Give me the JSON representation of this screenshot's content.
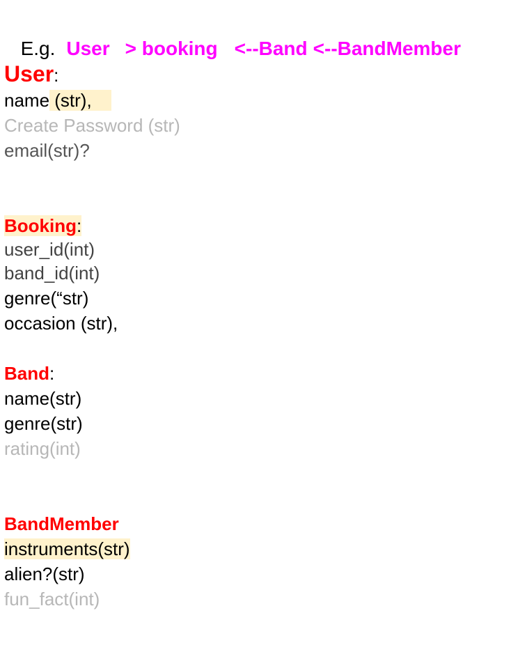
{
  "example": {
    "prefix": "E.g.",
    "user": "User",
    "booking": "> booking",
    "band": "<--Band",
    "bandmember": "<--BandMember"
  },
  "user": {
    "heading": "User",
    "colon": ":",
    "fields": {
      "name": "name",
      "name_type": " (str),",
      "password": "Create Password (str)",
      "email": "email(str)?"
    }
  },
  "booking": {
    "heading": "Booking",
    "colon": ":",
    "fields": {
      "user_id": "user_id(int)",
      "band_id": "band_id(int)",
      "genre": "genre(“str)",
      "occasion": "occasion (str),"
    }
  },
  "band": {
    "heading": "Band",
    "colon": ":",
    "fields": {
      "name": "name(str)",
      "genre": "genre(str)",
      "rating": "rating(int)"
    }
  },
  "bandmember": {
    "heading": "BandMember",
    "fields": {
      "instruments": "instruments(str)",
      "alien": "alien?(str)",
      "fun_fact": "fun_fact(int)"
    }
  },
  "colors": {
    "heading": "#ff0000",
    "example_accent": "#ff00ff",
    "highlight": "#fff2cc",
    "muted": "#b7b7b7"
  }
}
